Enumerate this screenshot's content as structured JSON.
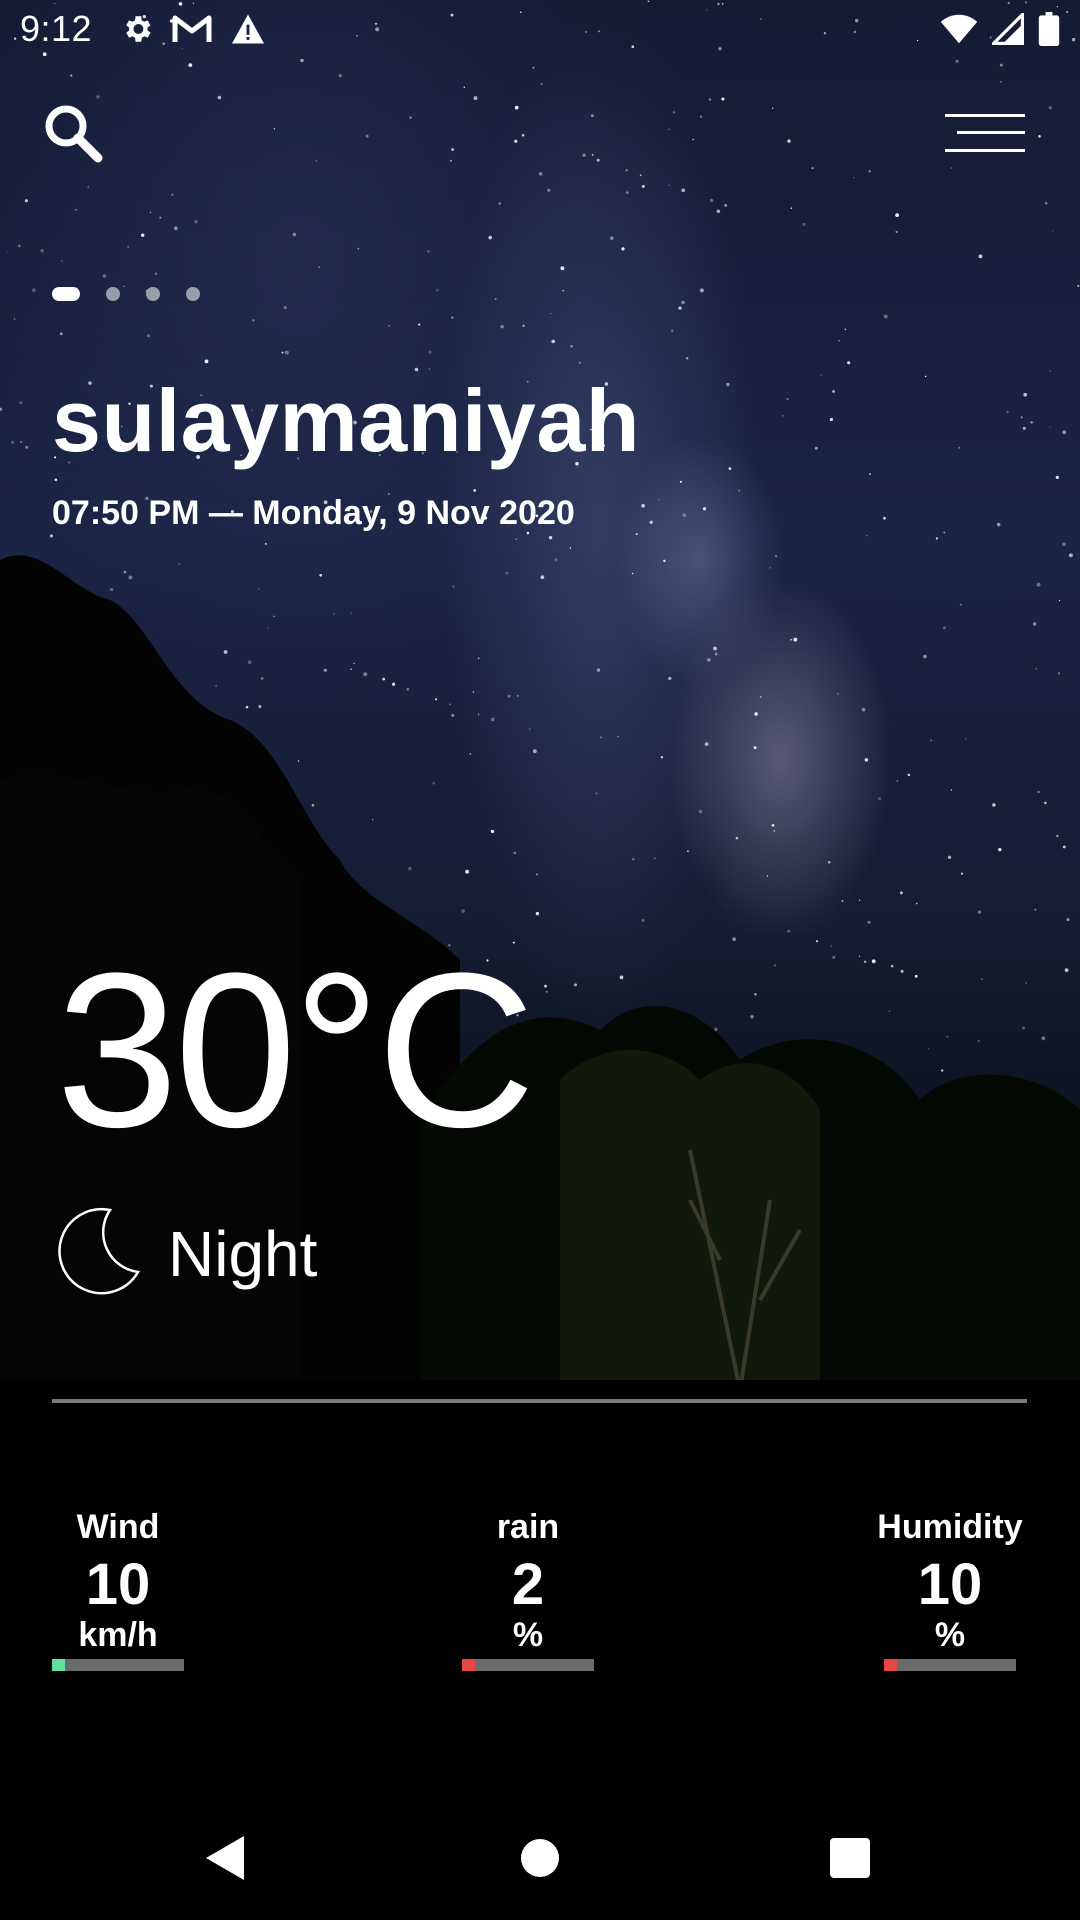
{
  "status_bar": {
    "time": "9:12",
    "left_icons": [
      "gear-icon",
      "gmail-icon",
      "warning-icon"
    ],
    "right_icons": [
      "wifi-icon",
      "signal-icon",
      "battery-icon"
    ]
  },
  "toolbar": {
    "search_icon": "search-icon",
    "menu_icon": "menu-icon"
  },
  "pager": {
    "count": 4,
    "active_index": 0
  },
  "location": {
    "city": "sulaymaniyah",
    "datetime": "07:50 PM — Monday, 9 Nov 2020"
  },
  "weather": {
    "temperature": "30°C",
    "condition": "Night",
    "condition_icon": "moon-icon"
  },
  "metrics": {
    "wind": {
      "label": "Wind",
      "value": "10",
      "unit": "km/h",
      "level": 0.1,
      "color": "#5ee0a0"
    },
    "rain": {
      "label": "rain",
      "value": "2",
      "unit": "%",
      "level": 0.1,
      "color": "#e84545"
    },
    "humidity": {
      "label": "Humidity",
      "value": "10",
      "unit": "%",
      "level": 0.1,
      "color": "#e84545"
    }
  },
  "nav_bar": {
    "icons": [
      "back-icon",
      "home-icon",
      "recents-icon"
    ]
  }
}
